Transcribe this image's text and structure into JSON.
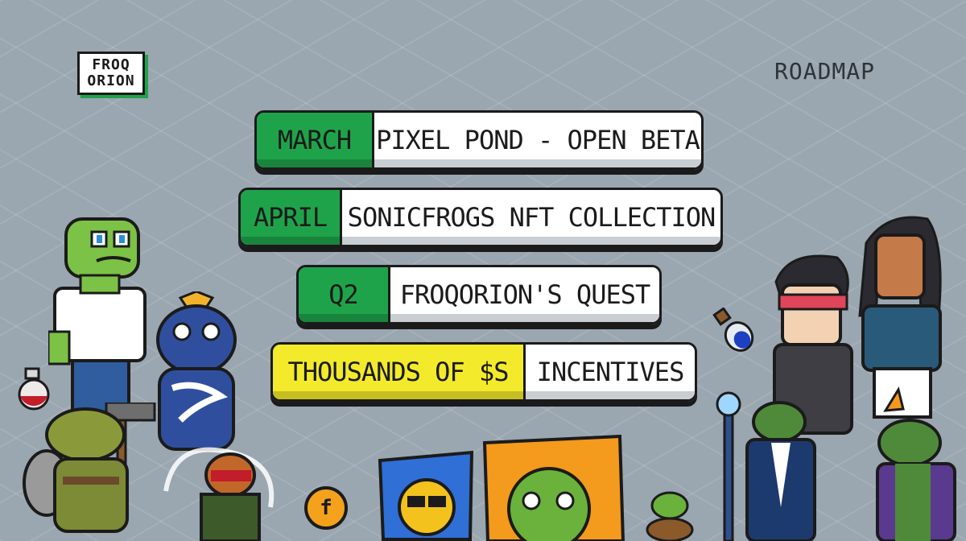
{
  "header": {
    "logo_line1": "FROQ",
    "logo_line2": "ORION",
    "nav_roadmap": "ROADMAP"
  },
  "roadmap": [
    {
      "when": "MARCH",
      "milestone": "PIXEL POND - OPEN BETA",
      "color": "#1fa34a"
    },
    {
      "when": "APRIL",
      "milestone": "SONICFROGS NFT COLLECTION",
      "color": "#1fa34a"
    },
    {
      "when": "Q2",
      "milestone": "FROQORION'S QUEST",
      "color": "#1fa34a"
    },
    {
      "when": "THOUSANDS OF $S",
      "milestone": "INCENTIVES",
      "color": "#f2ea2b"
    }
  ],
  "coin_symbol": "f",
  "colors": {
    "background": "#9aa6b0",
    "accent_green": "#1fa34a",
    "accent_yellow": "#f2ea2b",
    "outline": "#1b1b1b"
  },
  "icons": [
    "frog-character",
    "potion-red-icon",
    "potion-blue-icon",
    "coin-icon",
    "sunglasses-card",
    "frog-card",
    "mage-frog",
    "wizard-frog",
    "human-boy",
    "human-girl",
    "turtle-frog",
    "hooded-frog"
  ]
}
